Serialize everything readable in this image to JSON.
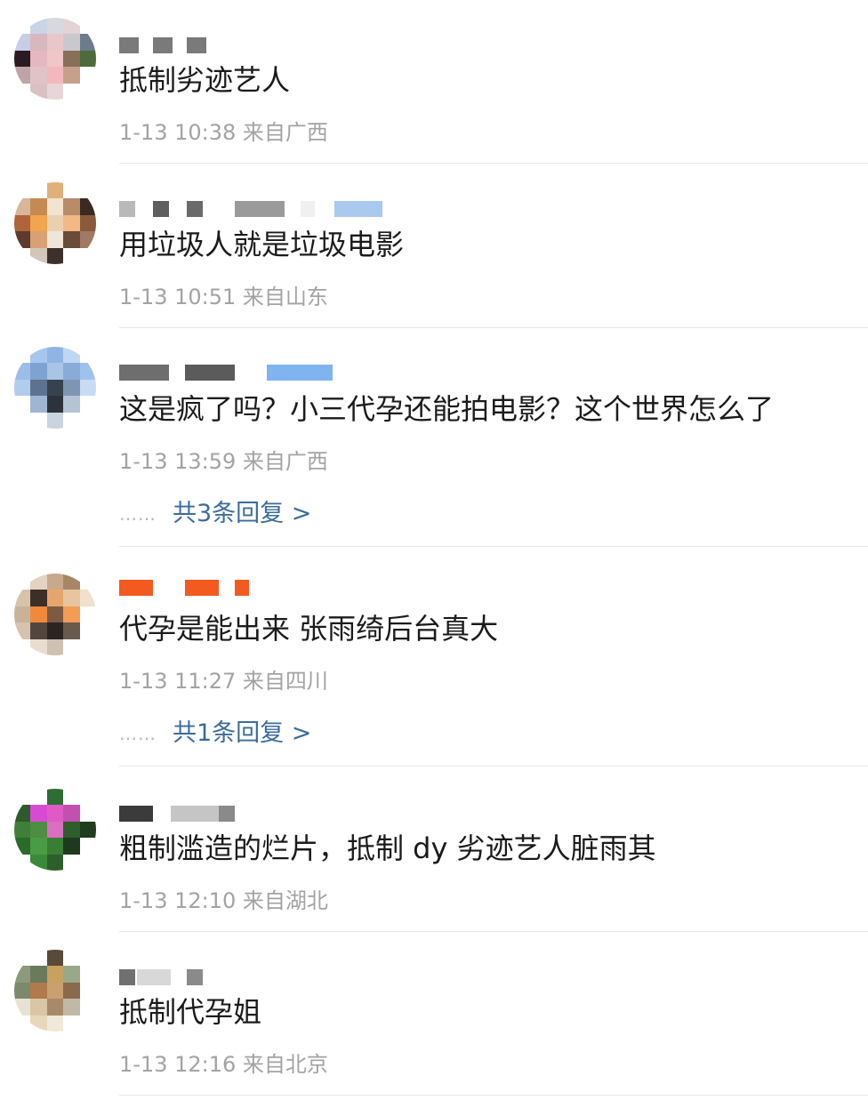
{
  "comments": [
    {
      "text": "抵制劣迹艺人",
      "meta": "1-13 10:38 来自广西",
      "avatar_colors": [
        "#ffffff",
        "#c9d4e9",
        "#d8d8e0",
        "#e3d2d6",
        "#ffffff",
        "#c7cde6",
        "#d8b7bd",
        "#e9c7c8",
        "#c9c8cc",
        "#6e7b8a",
        "#2b1a1f",
        "#e5b8bf",
        "#f0c6c8",
        "#8a6f58",
        "#4d6b3c",
        "#bfa4a7",
        "#e0c3c6",
        "#f2b8bd",
        "#c7a08a",
        "#ffffff",
        "#ffffff",
        "#d9c1c3",
        "#e8d5d8",
        "#ffffff",
        "#ffffff"
      ],
      "name_colors": [
        "#7a7a7a",
        "#7a7a7a",
        "#7a7a7a"
      ]
    },
    {
      "text": "用垃圾人就是垃圾电影",
      "meta": "1-13 10:51 来自山东",
      "avatar_colors": [
        "#ffffff",
        "#ffffff",
        "#e0b07a",
        "#ffffff",
        "#ffffff",
        "#d9b59a",
        "#c58a52",
        "#f1e3cf",
        "#b88b69",
        "#3a2a22",
        "#b0643a",
        "#f2a44e",
        "#ebd0b0",
        "#f3b886",
        "#8b5a3c",
        "#5c3a2e",
        "#d9a074",
        "#efe6da",
        "#6a4a3a",
        "#a07a62",
        "#ffffff",
        "#d2c6b8",
        "#3d302a",
        "#ffffff",
        "#ffffff"
      ],
      "name_colors": [
        "#b9b9b9",
        "#5f5f5f",
        "#6a6a6a",
        "#9a9a9a",
        "#f0f0f0",
        "#a9c9ef"
      ]
    },
    {
      "text": "这是疯了吗？小三代孕还能拍电影？这个世界怎么了",
      "meta": "1-13 13:59 来自广西",
      "replies": "共3条回复 >",
      "avatar_colors": [
        "#ffffff",
        "#a7c6ef",
        "#90b4e4",
        "#c0d7f3",
        "#ffffff",
        "#9dbde8",
        "#7ea3d3",
        "#aac4e6",
        "#89abd8",
        "#9ec2ee",
        "#b2cced",
        "#5c7290",
        "#37424f",
        "#7e96b3",
        "#c8dbf4",
        "#ffffff",
        "#9fb6d2",
        "#2e333b",
        "#b4c3d6",
        "#ffffff",
        "#ffffff",
        "#ffffff",
        "#c9d4e0",
        "#ffffff",
        "#ffffff"
      ],
      "name_colors": [
        "#6e6e6e",
        "#5b5b5b",
        "#7fb4f0"
      ]
    },
    {
      "text": "代孕是能出来 张雨绮后台真大",
      "meta": "1-13 11:27 来自四川",
      "replies": "共1条回复 >",
      "avatar_colors": [
        "#ffffff",
        "#e4d3c1",
        "#c9a88b",
        "#a88566",
        "#ffffff",
        "#d8c2aa",
        "#3b2f28",
        "#e6a56a",
        "#e9c59f",
        "#f1e0cb",
        "#c8b39a",
        "#f08a3a",
        "#7d5a44",
        "#f39c54",
        "#ffffff",
        "#d6c2ae",
        "#53463e",
        "#2a2523",
        "#6a5a4c",
        "#ffffff",
        "#ffffff",
        "#e8ddd0",
        "#cfc0b0",
        "#ffffff",
        "#ffffff"
      ],
      "name_colors": [
        "#f25a1f",
        "#f25a1f",
        "#f25a1f"
      ]
    },
    {
      "text": "粗制滥造的烂片，抵制 dy 劣迹艺人脏雨其",
      "meta": "1-13 12:10 来自湖北",
      "avatar_colors": [
        "#ffffff",
        "#ffffff",
        "#2c6e34",
        "#ffffff",
        "#ffffff",
        "#2f5a2c",
        "#d84ad3",
        "#e05ac6",
        "#c34fb1",
        "#ffffff",
        "#3f7f3a",
        "#4e8d44",
        "#d96fc0",
        "#2e5e2a",
        "#1f3d1f",
        "#2a6a2a",
        "#4a9b45",
        "#3a7d37",
        "#1e3a1e",
        "#ffffff",
        "#ffffff",
        "#3a8a3a",
        "#2c5f2c",
        "#ffffff",
        "#ffffff"
      ],
      "name_colors": [
        "#3b3b3b",
        "#c5c5c5",
        "#8a8a8a"
      ]
    },
    {
      "text": "抵制代孕姐",
      "meta": "1-13 12:16 来自北京",
      "avatar_colors": [
        "#ffffff",
        "#ffffff",
        "#5a4a3a",
        "#ffffff",
        "#ffffff",
        "#8a9a7a",
        "#6a7a5a",
        "#c8a060",
        "#9aa88a",
        "#ffffff",
        "#7a8a6a",
        "#b07a4a",
        "#c9a070",
        "#8a6a4a",
        "#ffffff",
        "#e8e2d2",
        "#d8c6a6",
        "#a88a6a",
        "#c2b8a8",
        "#ffffff",
        "#ffffff",
        "#e8d8b8",
        "#f0e8d8",
        "#ffffff",
        "#ffffff"
      ],
      "name_colors": [
        "#707070",
        "#d8d8d8",
        "#8a8a8a"
      ]
    }
  ]
}
